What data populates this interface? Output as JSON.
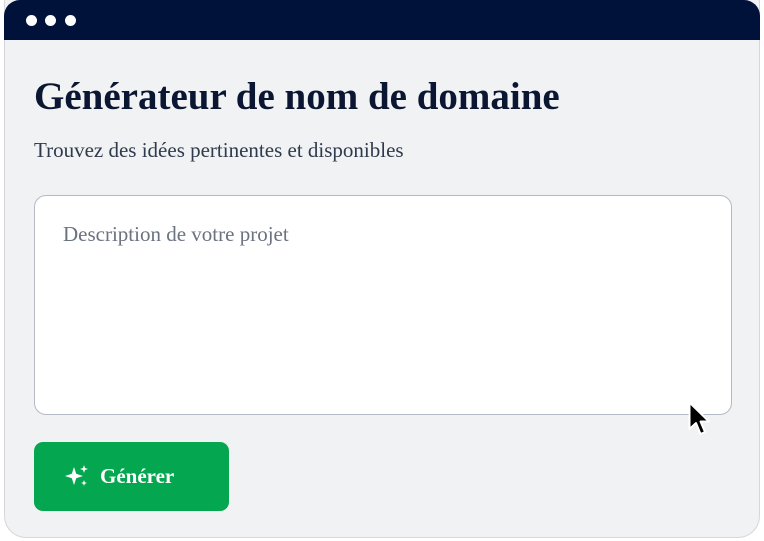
{
  "window": {
    "controls": [
      "dot",
      "dot",
      "dot"
    ]
  },
  "page": {
    "title": "Générateur de nom de domaine",
    "subtitle": "Trouvez des idées pertinentes et disponibles"
  },
  "form": {
    "description_placeholder": "Description de votre projet",
    "description_value": "",
    "generate_label": "Générer",
    "generate_icon": "sparkles-icon"
  },
  "colors": {
    "titlebar": "#00113a",
    "background": "#f1f2f4",
    "title_text": "#0b1632",
    "button": "#04a64f",
    "button_text": "#ffffff"
  },
  "pointer": {
    "icon": "mouse-pointer-icon"
  }
}
